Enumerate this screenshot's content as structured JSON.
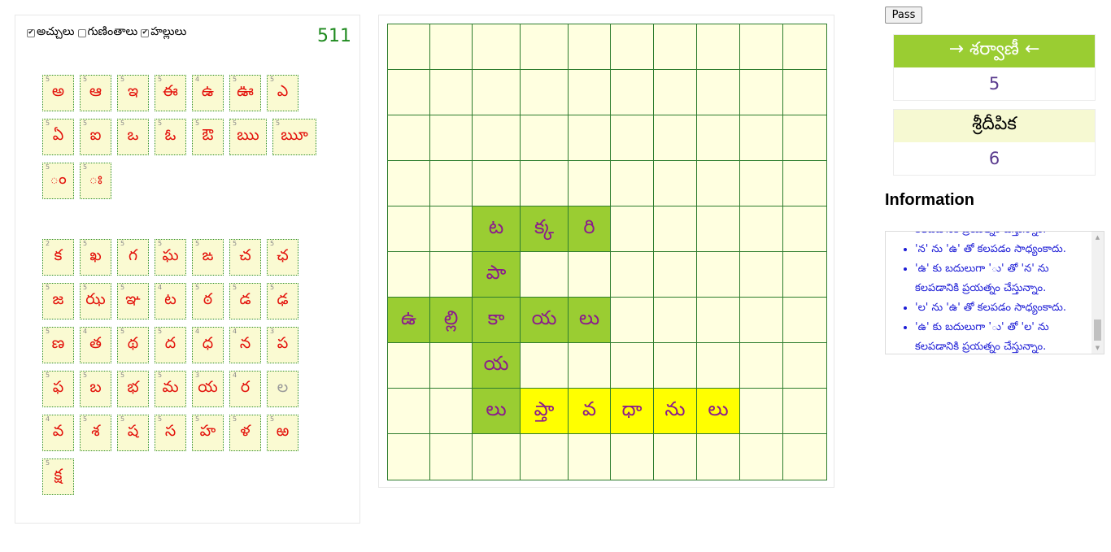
{
  "filters": [
    {
      "label": "అచ్చులు",
      "checked": true
    },
    {
      "label": "గుణింతాలు",
      "checked": false
    },
    {
      "label": "హల్లులు",
      "checked": true
    }
  ],
  "tiles_left": "511",
  "vowel_tiles": [
    {
      "char": "అ",
      "count": "5"
    },
    {
      "char": "ఆ",
      "count": "5"
    },
    {
      "char": "ఇ",
      "count": "5"
    },
    {
      "char": "ఈ",
      "count": "5"
    },
    {
      "char": "ఉ",
      "count": "4"
    },
    {
      "char": "ఊ",
      "count": "5"
    },
    {
      "char": "ఎ",
      "count": "5"
    },
    {
      "char": "ఏ",
      "count": "5"
    },
    {
      "char": "ఐ",
      "count": "5"
    },
    {
      "char": "ఒ",
      "count": "5"
    },
    {
      "char": "ఓ",
      "count": "5"
    },
    {
      "char": "ఔ",
      "count": "5"
    },
    {
      "char": "ఋ",
      "count": "5"
    },
    {
      "char": "ౠ",
      "count": "5"
    },
    {
      "char": "ం",
      "count": "5"
    },
    {
      "char": "ః",
      "count": "5"
    }
  ],
  "consonant_tiles": [
    {
      "char": "క",
      "count": "2"
    },
    {
      "char": "ఖ",
      "count": "5"
    },
    {
      "char": "గ",
      "count": "5"
    },
    {
      "char": "ఘ",
      "count": "5"
    },
    {
      "char": "ఙ",
      "count": "5"
    },
    {
      "char": "చ",
      "count": "5"
    },
    {
      "char": "ఛ",
      "count": "5"
    },
    {
      "char": "జ",
      "count": "5"
    },
    {
      "char": "ఝ",
      "count": "5"
    },
    {
      "char": "ఞ",
      "count": "5"
    },
    {
      "char": "ట",
      "count": "4"
    },
    {
      "char": "ఠ",
      "count": "5"
    },
    {
      "char": "డ",
      "count": "5"
    },
    {
      "char": "ఢ",
      "count": "5"
    },
    {
      "char": "ణ",
      "count": "5"
    },
    {
      "char": "త",
      "count": "4"
    },
    {
      "char": "థ",
      "count": "5"
    },
    {
      "char": "ద",
      "count": "5"
    },
    {
      "char": "ధ",
      "count": "4"
    },
    {
      "char": "న",
      "count": "4"
    },
    {
      "char": "ప",
      "count": "3"
    },
    {
      "char": "ఫ",
      "count": "5"
    },
    {
      "char": "బ",
      "count": "5"
    },
    {
      "char": "భ",
      "count": "5"
    },
    {
      "char": "మ",
      "count": "5"
    },
    {
      "char": "య",
      "count": "3"
    },
    {
      "char": "ర",
      "count": "4"
    },
    {
      "char": "ల",
      "count": "",
      "used": true
    },
    {
      "char": "వ",
      "count": "4"
    },
    {
      "char": "శ",
      "count": "5"
    },
    {
      "char": "ష",
      "count": "5"
    },
    {
      "char": "స",
      "count": "5"
    },
    {
      "char": "హ",
      "count": "5"
    },
    {
      "char": "ళ",
      "count": "5"
    },
    {
      "char": "ఱ",
      "count": "5"
    },
    {
      "char": "క్ష",
      "count": "5"
    }
  ],
  "board": {
    "rows": 10,
    "cols": 10,
    "cells": [
      {
        "row": 4,
        "col": 2,
        "text": "ట",
        "state": "placed"
      },
      {
        "row": 4,
        "col": 3,
        "text": "క్క",
        "state": "placed"
      },
      {
        "row": 4,
        "col": 4,
        "text": "రి",
        "state": "placed"
      },
      {
        "row": 5,
        "col": 2,
        "text": "పా",
        "state": "placed"
      },
      {
        "row": 6,
        "col": 0,
        "text": "ఉ",
        "state": "placed"
      },
      {
        "row": 6,
        "col": 1,
        "text": "ల్లి",
        "state": "placed"
      },
      {
        "row": 6,
        "col": 2,
        "text": "కా",
        "state": "placed"
      },
      {
        "row": 6,
        "col": 3,
        "text": "య",
        "state": "placed"
      },
      {
        "row": 6,
        "col": 4,
        "text": "లు",
        "state": "placed"
      },
      {
        "row": 7,
        "col": 2,
        "text": "య",
        "state": "placed"
      },
      {
        "row": 8,
        "col": 2,
        "text": "లు",
        "state": "placed"
      },
      {
        "row": 8,
        "col": 3,
        "text": "ప్తా",
        "state": "current"
      },
      {
        "row": 8,
        "col": 4,
        "text": "వ",
        "state": "current"
      },
      {
        "row": 8,
        "col": 5,
        "text": "ధా",
        "state": "current"
      },
      {
        "row": 8,
        "col": 6,
        "text": "ను",
        "state": "current"
      },
      {
        "row": 8,
        "col": 7,
        "text": "లు",
        "state": "current"
      }
    ]
  },
  "pass_label": "Pass",
  "players": [
    {
      "name": "→ శర్వాణీ ←",
      "score": "5",
      "active": true
    },
    {
      "name": "శ్రీదీపిక",
      "score": "6",
      "active": false
    }
  ],
  "information": {
    "title": "Information",
    "messages": [
      "కలపడానికి ప్రయత్నం చేస్తున్నాం.",
      "'న' ను 'ఉ' తో కలపడం సాధ్యంకాదు.",
      "'ఉ' కు బదులుగా 'ు' తో 'న' ను",
      "కలపడానికి ప్రయత్నం చేస్తున్నాం.",
      "'ల' ను 'ఉ' తో కలపడం సాధ్యంకాదు.",
      "'ఉ' కు బదులుగా 'ు' తో 'ల' ను",
      "కలపడానికి ప్రయత్నం చేస్తున్నాం."
    ]
  },
  "colors": {
    "placed": "#9acd32",
    "current": "#ffff00",
    "empty": "#ffffe0",
    "tile_bg": "#fafad2",
    "tile_text": "#e3120b",
    "board_text": "#8b1c8b",
    "score_green": "#1f8a1f"
  }
}
